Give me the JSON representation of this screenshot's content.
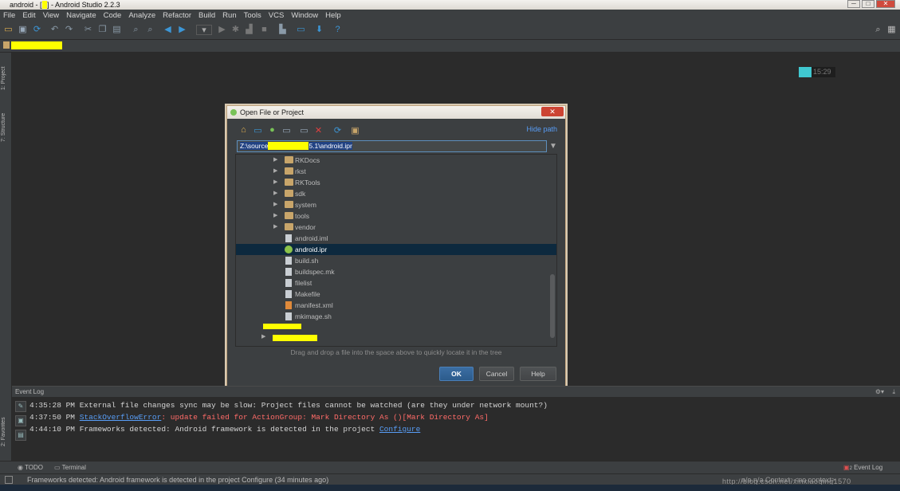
{
  "window": {
    "title_prefix": "android - [",
    "title_suffix": "] - Android Studio 2.2.3",
    "controls": [
      "─",
      "□",
      "✕"
    ]
  },
  "menu": [
    "File",
    "Edit",
    "View",
    "Navigate",
    "Code",
    "Analyze",
    "Refactor",
    "Build",
    "Run",
    "Tools",
    "VCS",
    "Window",
    "Help"
  ],
  "side_tabs": {
    "project": "1: Project",
    "structure": "7: Structure",
    "favorites": "2: Favorites"
  },
  "clock_text": "15:29",
  "dialog": {
    "title": "Open File or Project",
    "close": "✕",
    "hide_path": "Hide path",
    "path_start": "Z:\\source",
    "path_end": "5.1\\android.ipr",
    "tree": [
      {
        "name": "RKDocs",
        "type": "folder"
      },
      {
        "name": "rkst",
        "type": "folder"
      },
      {
        "name": "RKTools",
        "type": "folder"
      },
      {
        "name": "sdk",
        "type": "folder"
      },
      {
        "name": "system",
        "type": "folder"
      },
      {
        "name": "tools",
        "type": "folder"
      },
      {
        "name": "vendor",
        "type": "folder"
      },
      {
        "name": "android.iml",
        "type": "file"
      },
      {
        "name": "android.ipr",
        "type": "android",
        "selected": true
      },
      {
        "name": "build.sh",
        "type": "file"
      },
      {
        "name": "buildspec.mk",
        "type": "file"
      },
      {
        "name": "filelist",
        "type": "file"
      },
      {
        "name": "Makefile",
        "type": "file"
      },
      {
        "name": "manifest.xml",
        "type": "xml"
      },
      {
        "name": "mkimage.sh",
        "type": "file"
      }
    ],
    "hint": "Drag and drop a file into the space above to quickly locate it in the tree",
    "buttons": {
      "ok": "OK",
      "cancel": "Cancel",
      "help": "Help"
    }
  },
  "event_log": {
    "title": "Event Log",
    "lines": [
      {
        "time": "4:35:28 PM",
        "text": "External file changes sync may be slow: Project files cannot be watched (are they under network mount?)"
      },
      {
        "time": "4:37:50 PM",
        "link": "StackOverflowError",
        "error": ": update failed for ActionGroup: Mark Directory As ()[Mark Directory As]"
      },
      {
        "time": "4:44:10 PM",
        "text": "Frameworks detected: Android framework is detected in the project ",
        "link": "Configure"
      }
    ]
  },
  "bottom_tabs": {
    "todo": "TODO",
    "terminal": "Terminal",
    "event_log": "Event Log",
    "event_count": "2"
  },
  "status": {
    "message": "Frameworks detected: Android framework is detected in the project Configure (34 minutes ago)",
    "right": "n/a   n/a   Context: <no context>"
  },
  "watermark": "http://blog.csdn.net/xinxiaoqing1570"
}
